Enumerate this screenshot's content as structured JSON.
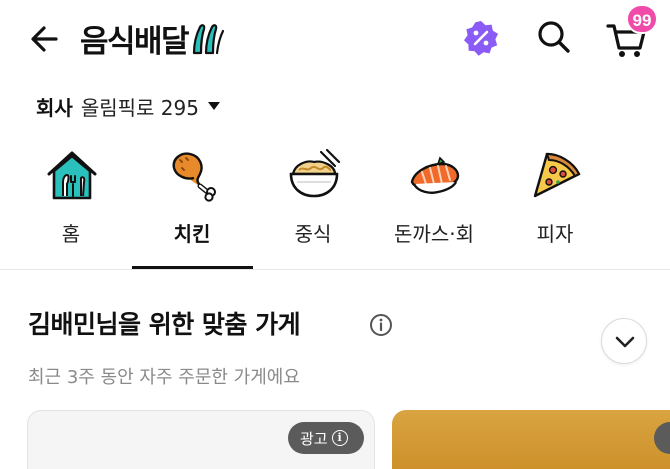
{
  "header": {
    "title": "음식배달",
    "cart_badge": "99"
  },
  "address": {
    "label": "회사",
    "value": "올림픽로 295"
  },
  "categories": [
    {
      "label": "홈",
      "icon": "home-fork-icon",
      "active": false
    },
    {
      "label": "치킨",
      "icon": "chicken-leg-icon",
      "active": true
    },
    {
      "label": "중식",
      "icon": "noodle-bowl-icon",
      "active": false
    },
    {
      "label": "돈까스·회",
      "icon": "salmon-sushi-icon",
      "active": false
    },
    {
      "label": "피자",
      "icon": "pizza-slice-icon",
      "active": false
    }
  ],
  "section": {
    "title": "김배민님을 위한 맞춤 가게",
    "subtitle": "최근 3주 동안 자주 주문한 가게에요"
  },
  "cards": {
    "ad_label": "광고"
  },
  "colors": {
    "brand_teal": "#2ac1bc",
    "badge_pink": "#f04ba8",
    "promo_purple": "#8a5cf5"
  }
}
